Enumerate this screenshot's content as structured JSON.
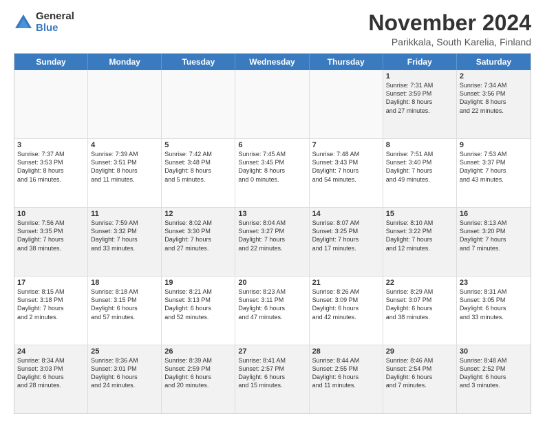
{
  "logo": {
    "general": "General",
    "blue": "Blue"
  },
  "header": {
    "month": "November 2024",
    "location": "Parikkala, South Karelia, Finland"
  },
  "weekdays": [
    "Sunday",
    "Monday",
    "Tuesday",
    "Wednesday",
    "Thursday",
    "Friday",
    "Saturday"
  ],
  "rows": [
    [
      {
        "day": "",
        "info": ""
      },
      {
        "day": "",
        "info": ""
      },
      {
        "day": "",
        "info": ""
      },
      {
        "day": "",
        "info": ""
      },
      {
        "day": "",
        "info": ""
      },
      {
        "day": "1",
        "info": "Sunrise: 7:31 AM\nSunset: 3:59 PM\nDaylight: 8 hours\nand 27 minutes."
      },
      {
        "day": "2",
        "info": "Sunrise: 7:34 AM\nSunset: 3:56 PM\nDaylight: 8 hours\nand 22 minutes."
      }
    ],
    [
      {
        "day": "3",
        "info": "Sunrise: 7:37 AM\nSunset: 3:53 PM\nDaylight: 8 hours\nand 16 minutes."
      },
      {
        "day": "4",
        "info": "Sunrise: 7:39 AM\nSunset: 3:51 PM\nDaylight: 8 hours\nand 11 minutes."
      },
      {
        "day": "5",
        "info": "Sunrise: 7:42 AM\nSunset: 3:48 PM\nDaylight: 8 hours\nand 5 minutes."
      },
      {
        "day": "6",
        "info": "Sunrise: 7:45 AM\nSunset: 3:45 PM\nDaylight: 8 hours\nand 0 minutes."
      },
      {
        "day": "7",
        "info": "Sunrise: 7:48 AM\nSunset: 3:43 PM\nDaylight: 7 hours\nand 54 minutes."
      },
      {
        "day": "8",
        "info": "Sunrise: 7:51 AM\nSunset: 3:40 PM\nDaylight: 7 hours\nand 49 minutes."
      },
      {
        "day": "9",
        "info": "Sunrise: 7:53 AM\nSunset: 3:37 PM\nDaylight: 7 hours\nand 43 minutes."
      }
    ],
    [
      {
        "day": "10",
        "info": "Sunrise: 7:56 AM\nSunset: 3:35 PM\nDaylight: 7 hours\nand 38 minutes."
      },
      {
        "day": "11",
        "info": "Sunrise: 7:59 AM\nSunset: 3:32 PM\nDaylight: 7 hours\nand 33 minutes."
      },
      {
        "day": "12",
        "info": "Sunrise: 8:02 AM\nSunset: 3:30 PM\nDaylight: 7 hours\nand 27 minutes."
      },
      {
        "day": "13",
        "info": "Sunrise: 8:04 AM\nSunset: 3:27 PM\nDaylight: 7 hours\nand 22 minutes."
      },
      {
        "day": "14",
        "info": "Sunrise: 8:07 AM\nSunset: 3:25 PM\nDaylight: 7 hours\nand 17 minutes."
      },
      {
        "day": "15",
        "info": "Sunrise: 8:10 AM\nSunset: 3:22 PM\nDaylight: 7 hours\nand 12 minutes."
      },
      {
        "day": "16",
        "info": "Sunrise: 8:13 AM\nSunset: 3:20 PM\nDaylight: 7 hours\nand 7 minutes."
      }
    ],
    [
      {
        "day": "17",
        "info": "Sunrise: 8:15 AM\nSunset: 3:18 PM\nDaylight: 7 hours\nand 2 minutes."
      },
      {
        "day": "18",
        "info": "Sunrise: 8:18 AM\nSunset: 3:15 PM\nDaylight: 6 hours\nand 57 minutes."
      },
      {
        "day": "19",
        "info": "Sunrise: 8:21 AM\nSunset: 3:13 PM\nDaylight: 6 hours\nand 52 minutes."
      },
      {
        "day": "20",
        "info": "Sunrise: 8:23 AM\nSunset: 3:11 PM\nDaylight: 6 hours\nand 47 minutes."
      },
      {
        "day": "21",
        "info": "Sunrise: 8:26 AM\nSunset: 3:09 PM\nDaylight: 6 hours\nand 42 minutes."
      },
      {
        "day": "22",
        "info": "Sunrise: 8:29 AM\nSunset: 3:07 PM\nDaylight: 6 hours\nand 38 minutes."
      },
      {
        "day": "23",
        "info": "Sunrise: 8:31 AM\nSunset: 3:05 PM\nDaylight: 6 hours\nand 33 minutes."
      }
    ],
    [
      {
        "day": "24",
        "info": "Sunrise: 8:34 AM\nSunset: 3:03 PM\nDaylight: 6 hours\nand 28 minutes."
      },
      {
        "day": "25",
        "info": "Sunrise: 8:36 AM\nSunset: 3:01 PM\nDaylight: 6 hours\nand 24 minutes."
      },
      {
        "day": "26",
        "info": "Sunrise: 8:39 AM\nSunset: 2:59 PM\nDaylight: 6 hours\nand 20 minutes."
      },
      {
        "day": "27",
        "info": "Sunrise: 8:41 AM\nSunset: 2:57 PM\nDaylight: 6 hours\nand 15 minutes."
      },
      {
        "day": "28",
        "info": "Sunrise: 8:44 AM\nSunset: 2:55 PM\nDaylight: 6 hours\nand 11 minutes."
      },
      {
        "day": "29",
        "info": "Sunrise: 8:46 AM\nSunset: 2:54 PM\nDaylight: 6 hours\nand 7 minutes."
      },
      {
        "day": "30",
        "info": "Sunrise: 8:48 AM\nSunset: 2:52 PM\nDaylight: 6 hours\nand 3 minutes."
      }
    ]
  ],
  "alt_rows": [
    0,
    2,
    4
  ]
}
